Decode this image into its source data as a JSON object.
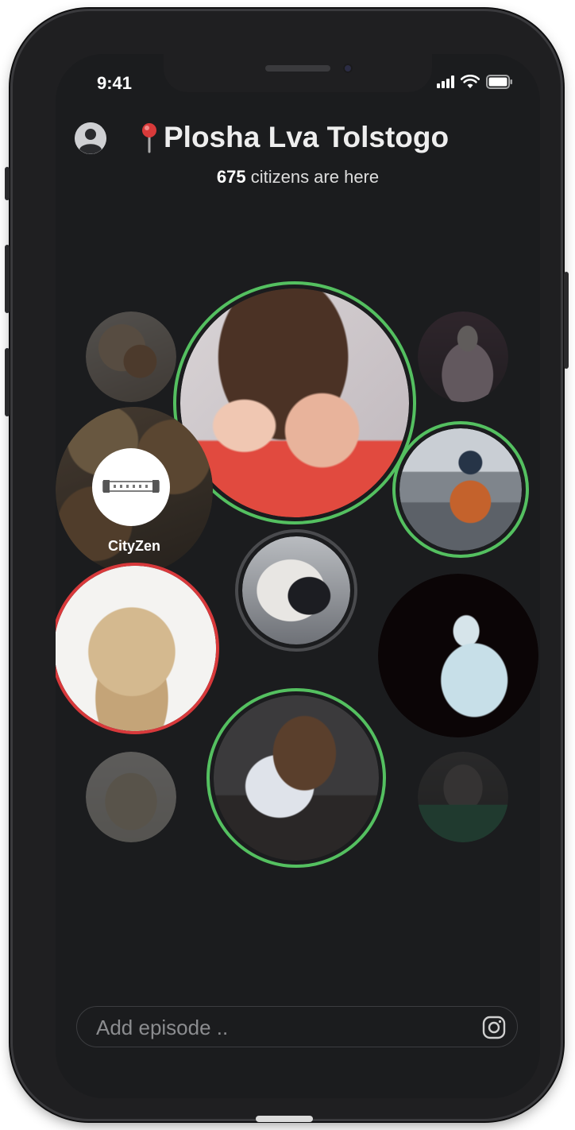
{
  "status_bar": {
    "time": "9:41"
  },
  "header": {
    "location_name": "Plosha Lva Tolstogo",
    "citizens_count": "675",
    "citizens_suffix": " citizens are here"
  },
  "bubbles": {
    "cityzen_label": "CityZen"
  },
  "composer": {
    "placeholder": "Add episode .."
  },
  "colors": {
    "accent_green": "#54c060",
    "accent_red": "#d8393b",
    "background": "#1b1c1e"
  },
  "icons": [
    "avatar-icon",
    "pin-icon",
    "instagram-icon",
    "signal-icon",
    "wifi-icon",
    "battery-icon"
  ]
}
